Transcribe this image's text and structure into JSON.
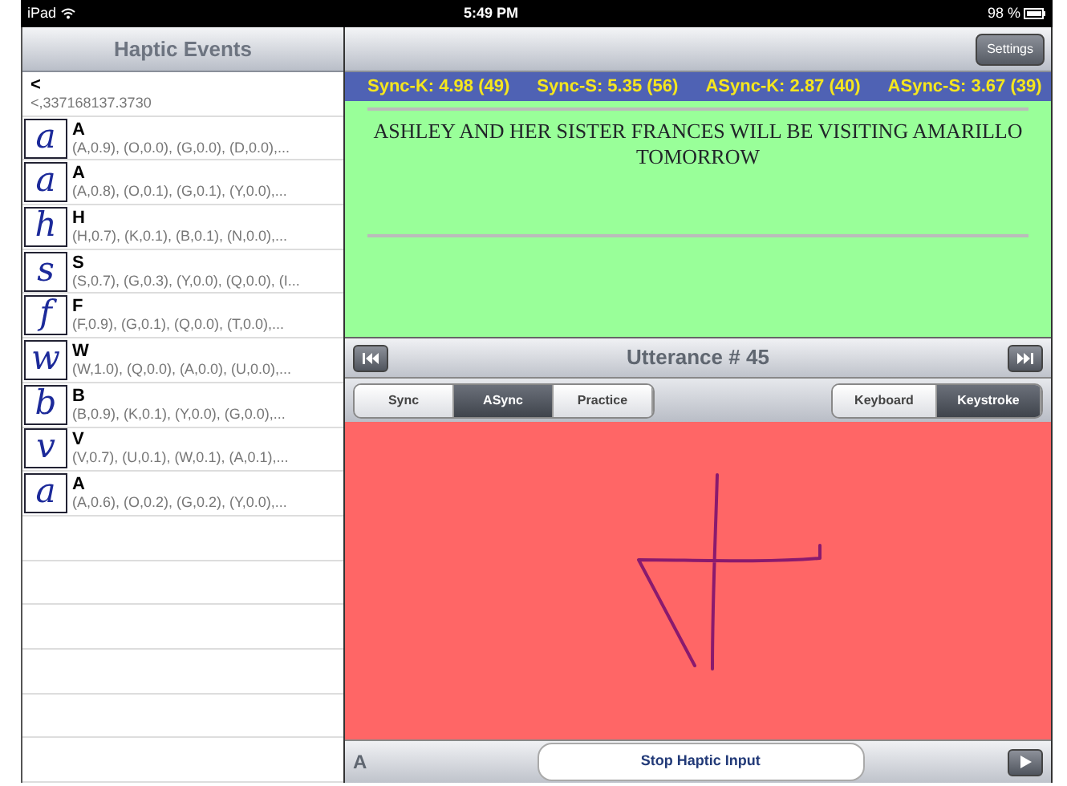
{
  "status_bar": {
    "device": "iPad",
    "time": "5:49 PM",
    "battery": "98 %"
  },
  "sidebar": {
    "title": "Haptic Events",
    "header": {
      "title": "<",
      "detail": "<,337168137.3730"
    },
    "items": [
      {
        "glyph": "a",
        "title": "A",
        "detail": "(A,0.9), (O,0.0), (G,0.0), (D,0.0),..."
      },
      {
        "glyph": "a",
        "title": "A",
        "detail": "(A,0.8), (O,0.1), (G,0.1), (Y,0.0),..."
      },
      {
        "glyph": "h",
        "title": "H",
        "detail": "(H,0.7), (K,0.1), (B,0.1), (N,0.0),..."
      },
      {
        "glyph": "s",
        "title": "S",
        "detail": "(S,0.7), (G,0.3), (Y,0.0), (Q,0.0), (I..."
      },
      {
        "glyph": "f",
        "title": "F",
        "detail": "(F,0.9), (G,0.1), (Q,0.0), (T,0.0),..."
      },
      {
        "glyph": "w",
        "title": "W",
        "detail": "(W,1.0), (Q,0.0), (A,0.0), (U,0.0),..."
      },
      {
        "glyph": "b",
        "title": "B",
        "detail": "(B,0.9), (K,0.1), (Y,0.0), (G,0.0),..."
      },
      {
        "glyph": "v",
        "title": "V",
        "detail": "(V,0.7), (U,0.1), (W,0.1), (A,0.1),..."
      },
      {
        "glyph": "a",
        "title": "A",
        "detail": "(A,0.6), (O,0.2), (G,0.2), (Y,0.0),..."
      }
    ]
  },
  "toolbar": {
    "button": "Settings"
  },
  "scores": [
    "Sync-K: 4.98 (49)",
    "Sync-S: 5.35 (56)",
    "ASync-K: 2.87 (40)",
    "ASync-S: 3.67 (39)"
  ],
  "sentence": "ASHLEY AND HER SISTER FRANCES WILL BE VISITING AMARILLO TOMORROW",
  "utterance": "Utterance # 45",
  "mode_tabs": [
    {
      "label": "Sync",
      "selected": false
    },
    {
      "label": "ASync",
      "selected": true
    },
    {
      "label": "Practice",
      "selected": false
    }
  ],
  "input_tabs": [
    {
      "label": "Keyboard",
      "selected": false
    },
    {
      "label": "Keystroke",
      "selected": true
    }
  ],
  "bottom_bar": {
    "letter": "A",
    "button": "Stop Haptic Input"
  }
}
